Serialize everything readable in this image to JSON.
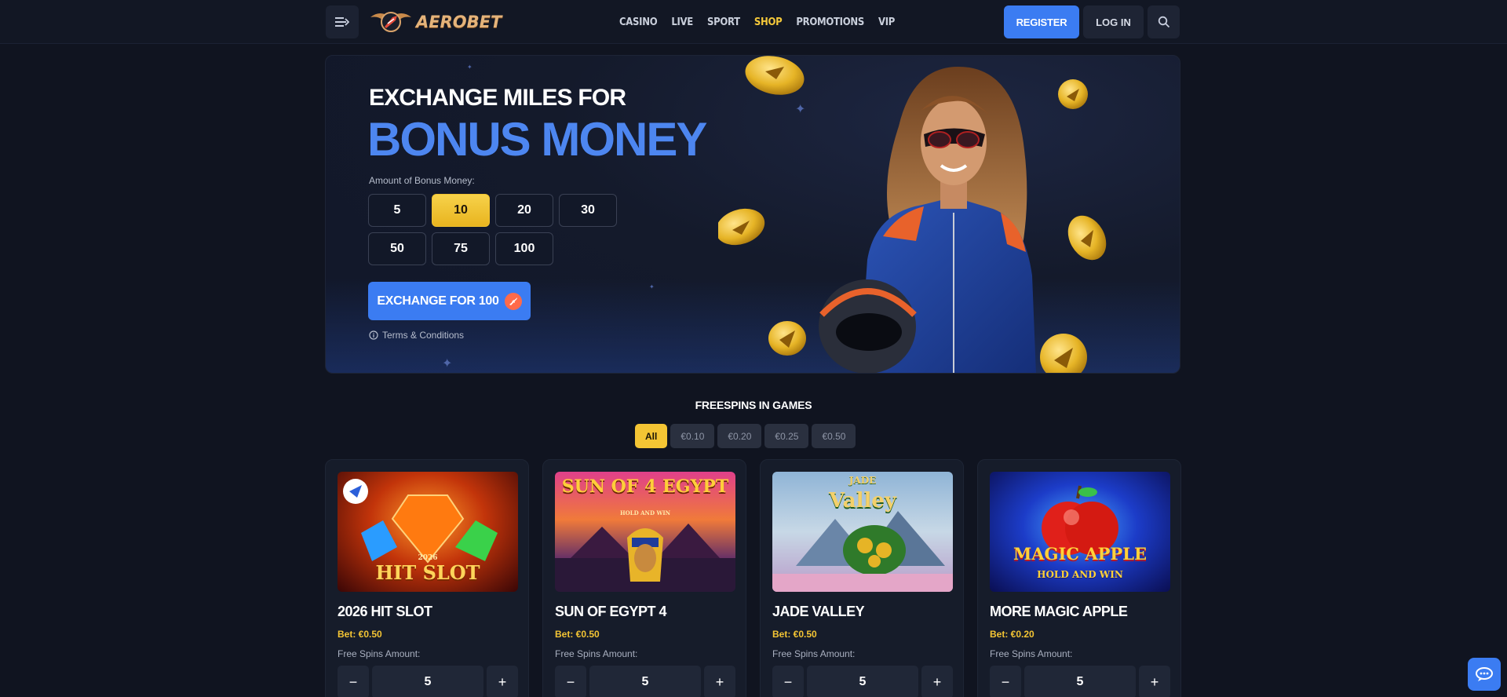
{
  "header": {
    "logo_text": "AEROBET",
    "nav": [
      {
        "label": "CASINO",
        "active": false
      },
      {
        "label": "LIVE",
        "active": false
      },
      {
        "label": "SPORT",
        "active": false
      },
      {
        "label": "SHOP",
        "active": true
      },
      {
        "label": "PROMOTIONS",
        "active": false
      },
      {
        "label": "VIP",
        "active": false
      }
    ],
    "register_label": "REGISTER",
    "login_label": "LOG IN",
    "icons": {
      "menu": "menu-icon",
      "search": "search-icon"
    }
  },
  "hero": {
    "title_line1": "EXCHANGE MILES FOR",
    "title_line2": "BONUS MONEY",
    "amount_label": "Amount of Bonus Money:",
    "amounts": [
      "5",
      "10",
      "20",
      "30",
      "50",
      "75",
      "100"
    ],
    "selected_amount": "10",
    "exchange_label": "EXCHANGE FOR 100",
    "terms_label": "Terms & Conditions"
  },
  "freespins": {
    "title": "FREESPINS IN GAMES",
    "filters": [
      {
        "label": "All",
        "active": true
      },
      {
        "label": "€0.10",
        "active": false
      },
      {
        "label": "€0.20",
        "active": false
      },
      {
        "label": "€0.25",
        "active": false
      },
      {
        "label": "€0.50",
        "active": false
      }
    ],
    "games": [
      {
        "title": "2026 HIT SLOT",
        "bet": "Bet: €0.50",
        "fs_label": "Free Spins Amount:",
        "amount": "5",
        "art_text": "HIT SLOT",
        "art_sub": "2026"
      },
      {
        "title": "SUN OF EGYPT 4",
        "bet": "Bet: €0.50",
        "fs_label": "Free Spins Amount:",
        "amount": "5",
        "art_text": "SUN OF 4 EGYPT",
        "art_sub": "HOLD AND WIN"
      },
      {
        "title": "JADE VALLEY",
        "bet": "Bet: €0.50",
        "fs_label": "Free Spins Amount:",
        "amount": "5",
        "art_text": "Valley",
        "art_sub": "JADE"
      },
      {
        "title": "MORE MAGIC APPLE",
        "bet": "Bet: €0.20",
        "fs_label": "Free Spins Amount:",
        "amount": "5",
        "art_text": "MAGIC APPLE",
        "art_sub": "HOLD AND WIN"
      }
    ]
  },
  "colors": {
    "accent": "#3b7cf2",
    "gold": "#f4c534",
    "background": "#101420"
  }
}
